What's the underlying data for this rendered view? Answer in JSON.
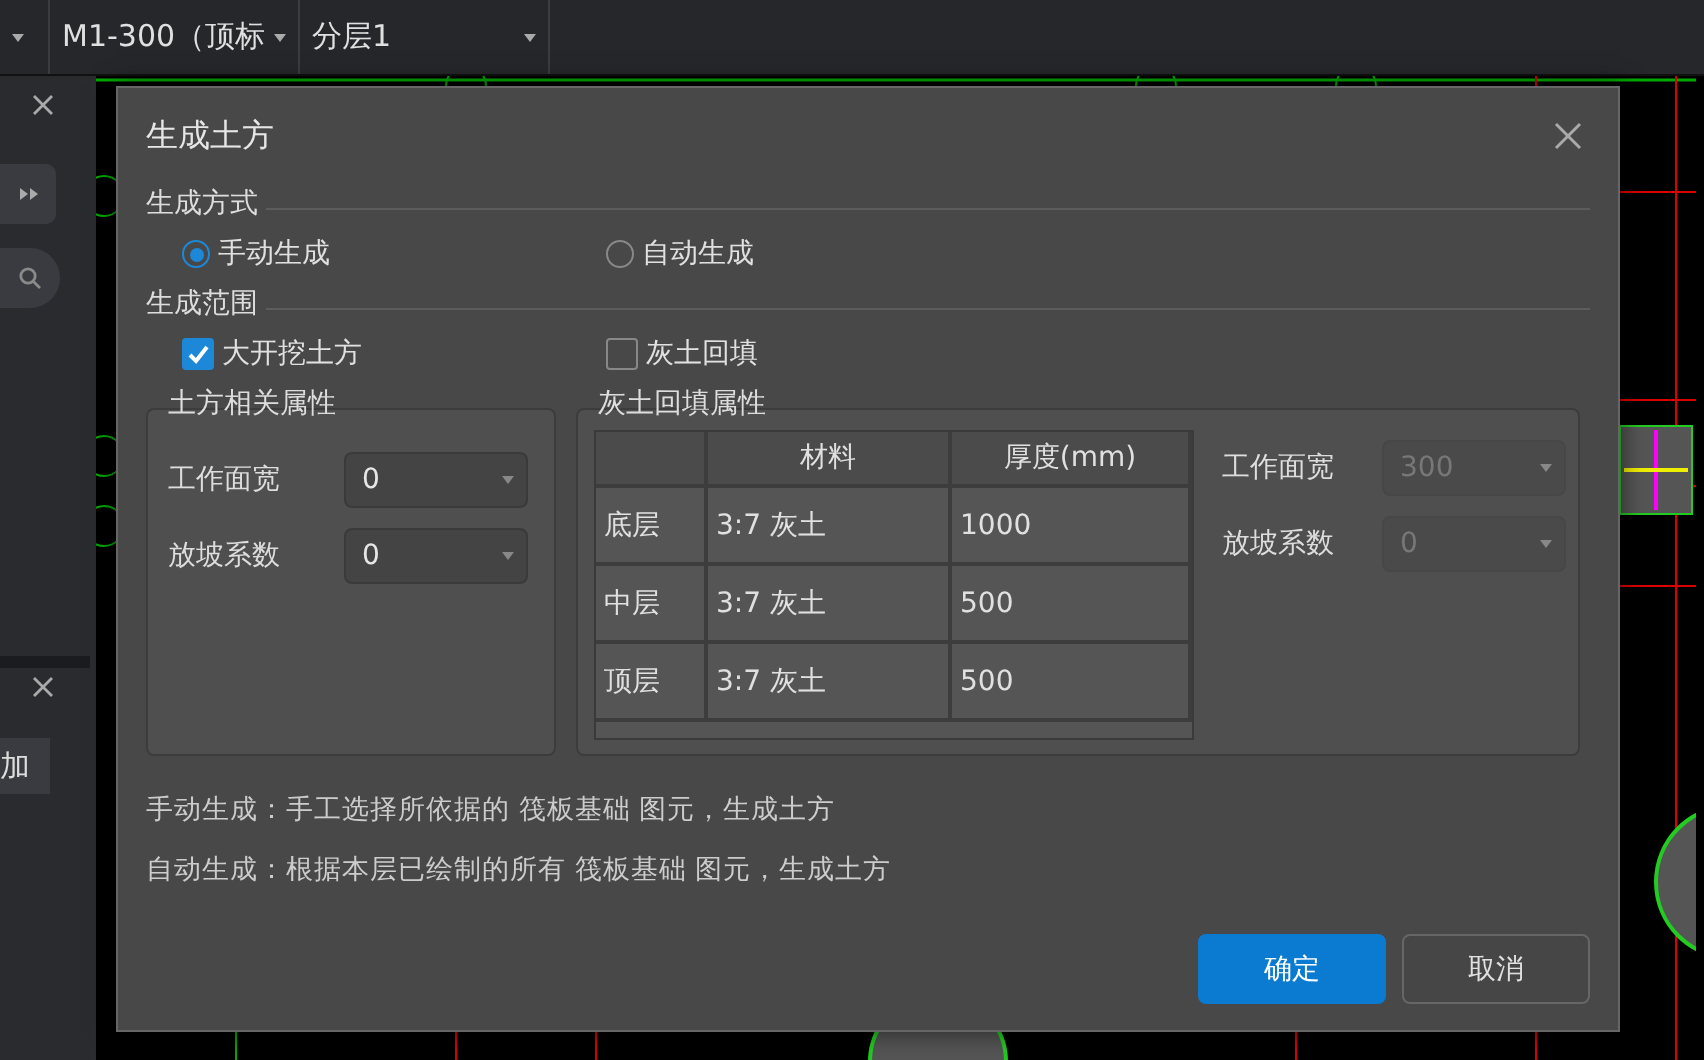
{
  "toolbar": {
    "dropdowns": [
      {
        "value": "M1-300（顶标"
      },
      {
        "value": "分层1"
      }
    ]
  },
  "side_panel": {
    "tab": "加"
  },
  "dialog": {
    "title": "生成土方",
    "mode": {
      "label": "生成方式",
      "options": [
        {
          "label": "手动生成",
          "selected": true
        },
        {
          "label": "自动生成",
          "selected": false
        }
      ]
    },
    "range": {
      "label": "生成范围",
      "options": [
        {
          "label": "大开挖土方",
          "checked": true
        },
        {
          "label": "灰土回填",
          "checked": false
        }
      ]
    },
    "earth_group": {
      "title": "土方相关属性",
      "fields": [
        {
          "label": "工作面宽",
          "value": "0",
          "disabled": false
        },
        {
          "label": "放坡系数",
          "value": "0",
          "disabled": false
        }
      ]
    },
    "lime_group": {
      "title": "灰土回填属性",
      "table": {
        "columns": [
          "材料",
          "厚度(mm)"
        ],
        "rows": [
          {
            "layer": "底层",
            "material": "3:7 灰土",
            "thickness": "1000"
          },
          {
            "layer": "中层",
            "material": "3:7 灰土",
            "thickness": "500"
          },
          {
            "layer": "顶层",
            "material": "3:7 灰土",
            "thickness": "500"
          }
        ]
      },
      "fields": [
        {
          "label": "工作面宽",
          "value": "300",
          "disabled": true
        },
        {
          "label": "放坡系数",
          "value": "0",
          "disabled": true
        }
      ]
    },
    "notes": [
      "手动生成：手工选择所依据的 筏板基础 图元，生成土方",
      "自动生成：根据本层已绘制的所有 筏板基础 图元，生成土方"
    ],
    "buttons": [
      {
        "label": "确定",
        "kind": "primary"
      },
      {
        "label": "取消",
        "kind": "secondary"
      }
    ]
  }
}
